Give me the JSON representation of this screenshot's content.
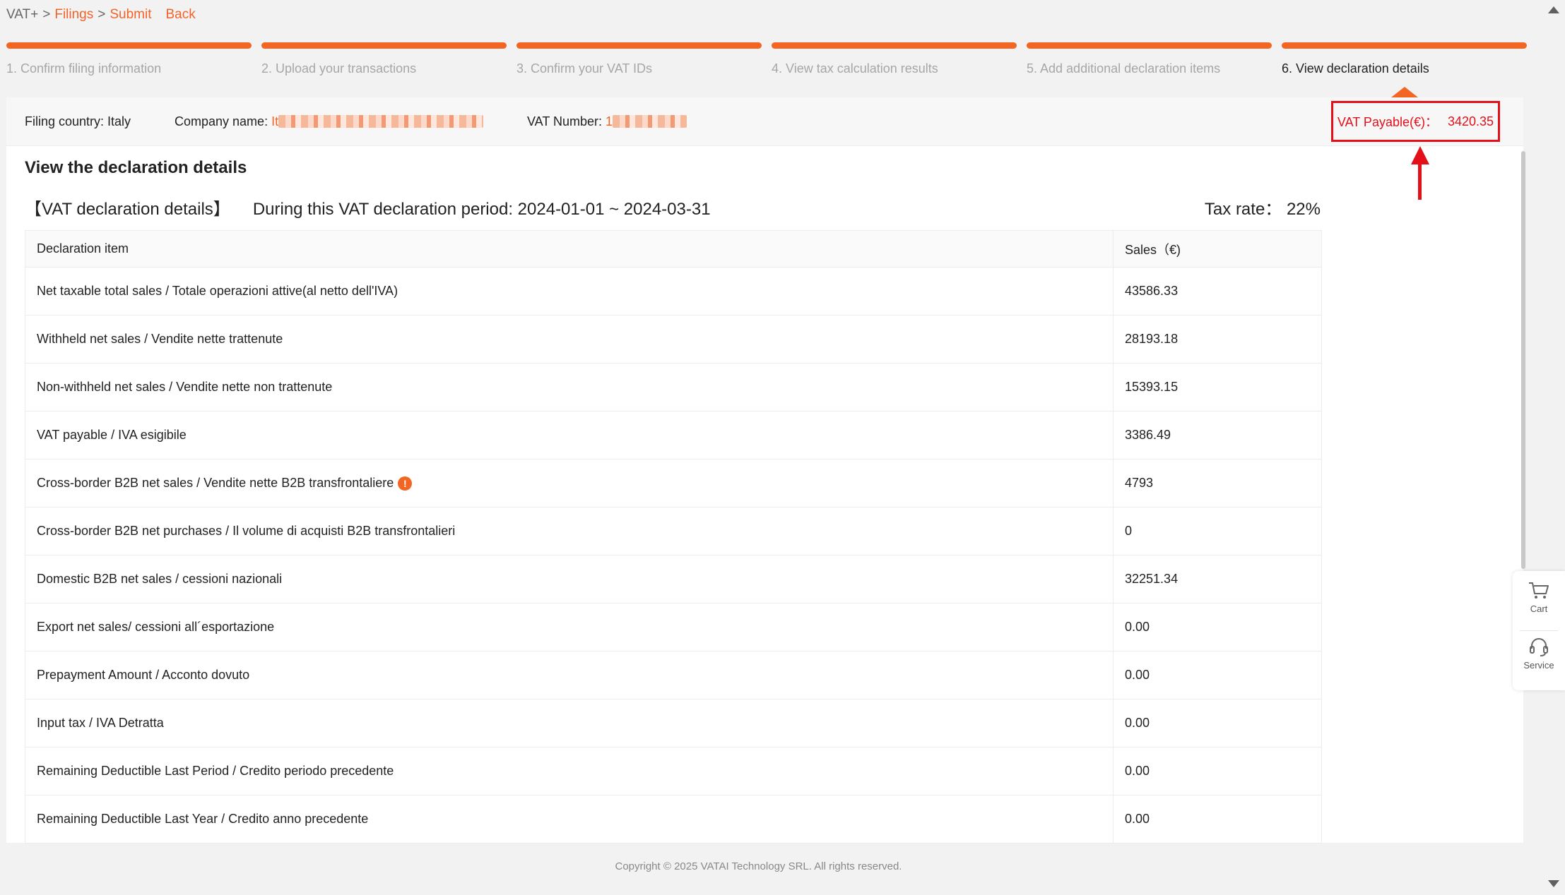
{
  "breadcrumb": {
    "root": "VAT+",
    "filings": "Filings",
    "submit": "Submit",
    "back": "Back"
  },
  "steps": [
    {
      "label": "1. Confirm filing information"
    },
    {
      "label": "2. Upload your transactions"
    },
    {
      "label": "3. Confirm your VAT IDs"
    },
    {
      "label": "4. View tax calculation results"
    },
    {
      "label": "5. Add additional declaration items"
    },
    {
      "label": "6. View declaration details"
    }
  ],
  "info": {
    "country_label": "Filing country: ",
    "country": "Italy",
    "company_label": "Company name: ",
    "company_prefix": "It",
    "vat_label": "VAT Number: ",
    "vat_prefix": "1",
    "vat_payable_label": "VAT Payable(€)：",
    "vat_payable_value": "3420.35"
  },
  "section_title": "View the declaration details",
  "declaration": {
    "title": "【VAT declaration details】",
    "period": "During this VAT declaration period: 2024-01-01 ~ 2024-03-31",
    "tax_rate": "Tax rate：  22%"
  },
  "table": {
    "headers": {
      "item": "Declaration item",
      "sales": "Sales（€)"
    },
    "rows": [
      {
        "item": "Net taxable total sales / Totale operazioni attive(al netto dell'IVA)",
        "value": "43586.33"
      },
      {
        "item": "Withheld net sales / Vendite nette trattenute",
        "value": "28193.18"
      },
      {
        "item": "Non-withheld net sales / Vendite nette non trattenute",
        "value": "15393.15"
      },
      {
        "item": "VAT payable / IVA esigibile",
        "value": "3386.49"
      },
      {
        "item": "Cross-border B2B net sales / Vendite nette B2B transfrontaliere",
        "value": "4793"
      },
      {
        "item": "Cross-border B2B net purchases / Il volume di acquisti B2B transfrontalieri",
        "value": "0"
      },
      {
        "item": "Domestic B2B net sales / cessioni nazionali",
        "value": "32251.34"
      },
      {
        "item": "Export net sales/ cessioni all´esportazione",
        "value": "0.00"
      },
      {
        "item": "Prepayment Amount / Acconto dovuto",
        "value": "0.00"
      },
      {
        "item": "Input tax / IVA Detratta",
        "value": "0.00"
      },
      {
        "item": "Remaining Deductible Last Period / Credito periodo precedente",
        "value": "0.00"
      },
      {
        "item": "Remaining Deductible Last Year / Credito anno precedente",
        "value": "0.00"
      }
    ]
  },
  "side": {
    "cart": "Cart",
    "service": "Service"
  },
  "footer": "Copyright © 2025 VATAI Technology SRL. All rights reserved.",
  "colors": {
    "accent": "#f26522",
    "highlight": "#e3101a"
  }
}
